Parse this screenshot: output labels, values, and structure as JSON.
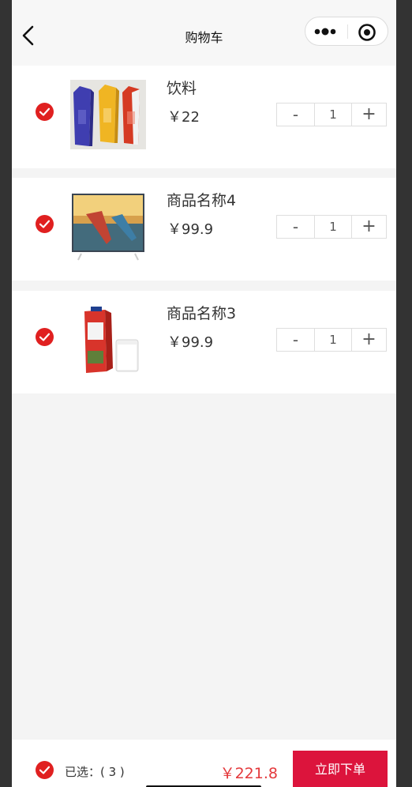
{
  "navbar": {
    "title": "购物车"
  },
  "cart": {
    "items": [
      {
        "name": "饮料",
        "price": "￥22",
        "quantity": "1",
        "checked": true,
        "image": "juice-cartons"
      },
      {
        "name": "商品名称4",
        "price": "￥99.9",
        "quantity": "1",
        "checked": true,
        "image": "kayak-tv-screen"
      },
      {
        "name": "商品名称3",
        "price": "￥99.9",
        "quantity": "1",
        "checked": true,
        "image": "milk-carton-glass"
      }
    ],
    "minus_label": "-",
    "plus_label": "+"
  },
  "footer": {
    "selected_label": "已选：( 3 )",
    "total": "￥221.8",
    "order_button": "立即下单"
  },
  "colors": {
    "accent_red": "#dc143c",
    "check_red": "#e02020",
    "price_red": "#e4393c"
  }
}
